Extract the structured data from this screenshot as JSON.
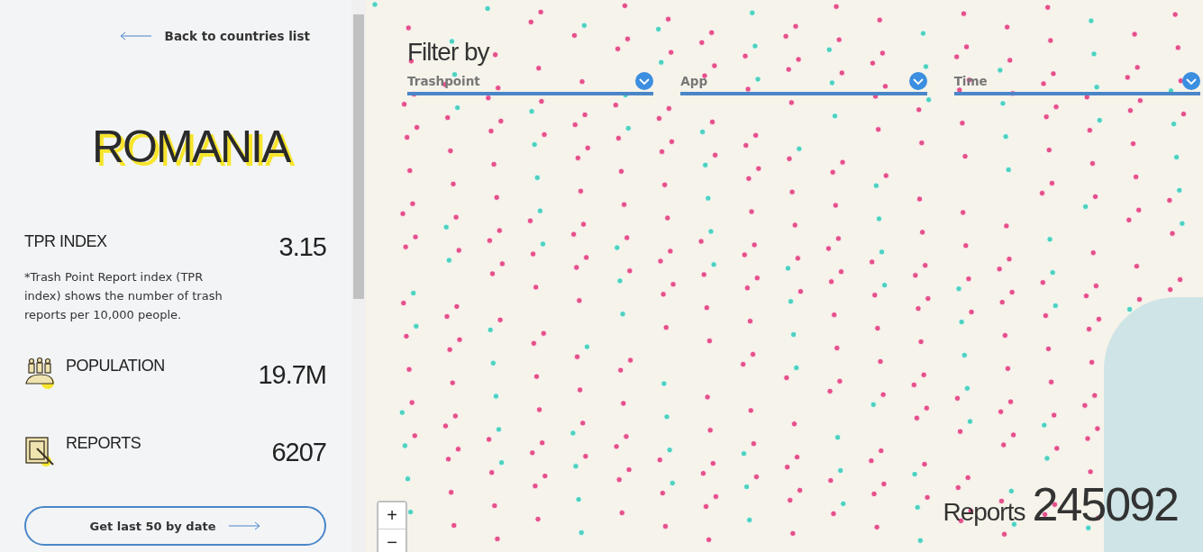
{
  "sidebar": {
    "back_link": "Back to countries list",
    "country": "ROMANIA",
    "tpr": {
      "label": "TPR INDEX",
      "value": "3.15",
      "note": "*Trash Point Report index (TPR index) shows the number of trash reports per 10,000 people."
    },
    "stats": [
      {
        "kind": "population",
        "label": "POPULATION",
        "value": "19.7M"
      },
      {
        "kind": "reports",
        "label": "REPORTS",
        "value": "6207"
      }
    ],
    "button": "Get last 50 by date"
  },
  "map": {
    "filter_title": "Filter by",
    "filters": [
      {
        "label": "Trashpoint"
      },
      {
        "label": "App"
      },
      {
        "label": "Time"
      }
    ],
    "zoom": {
      "in": "+",
      "out": "−"
    },
    "reports_label": "Reports",
    "reports_count": "245092"
  }
}
